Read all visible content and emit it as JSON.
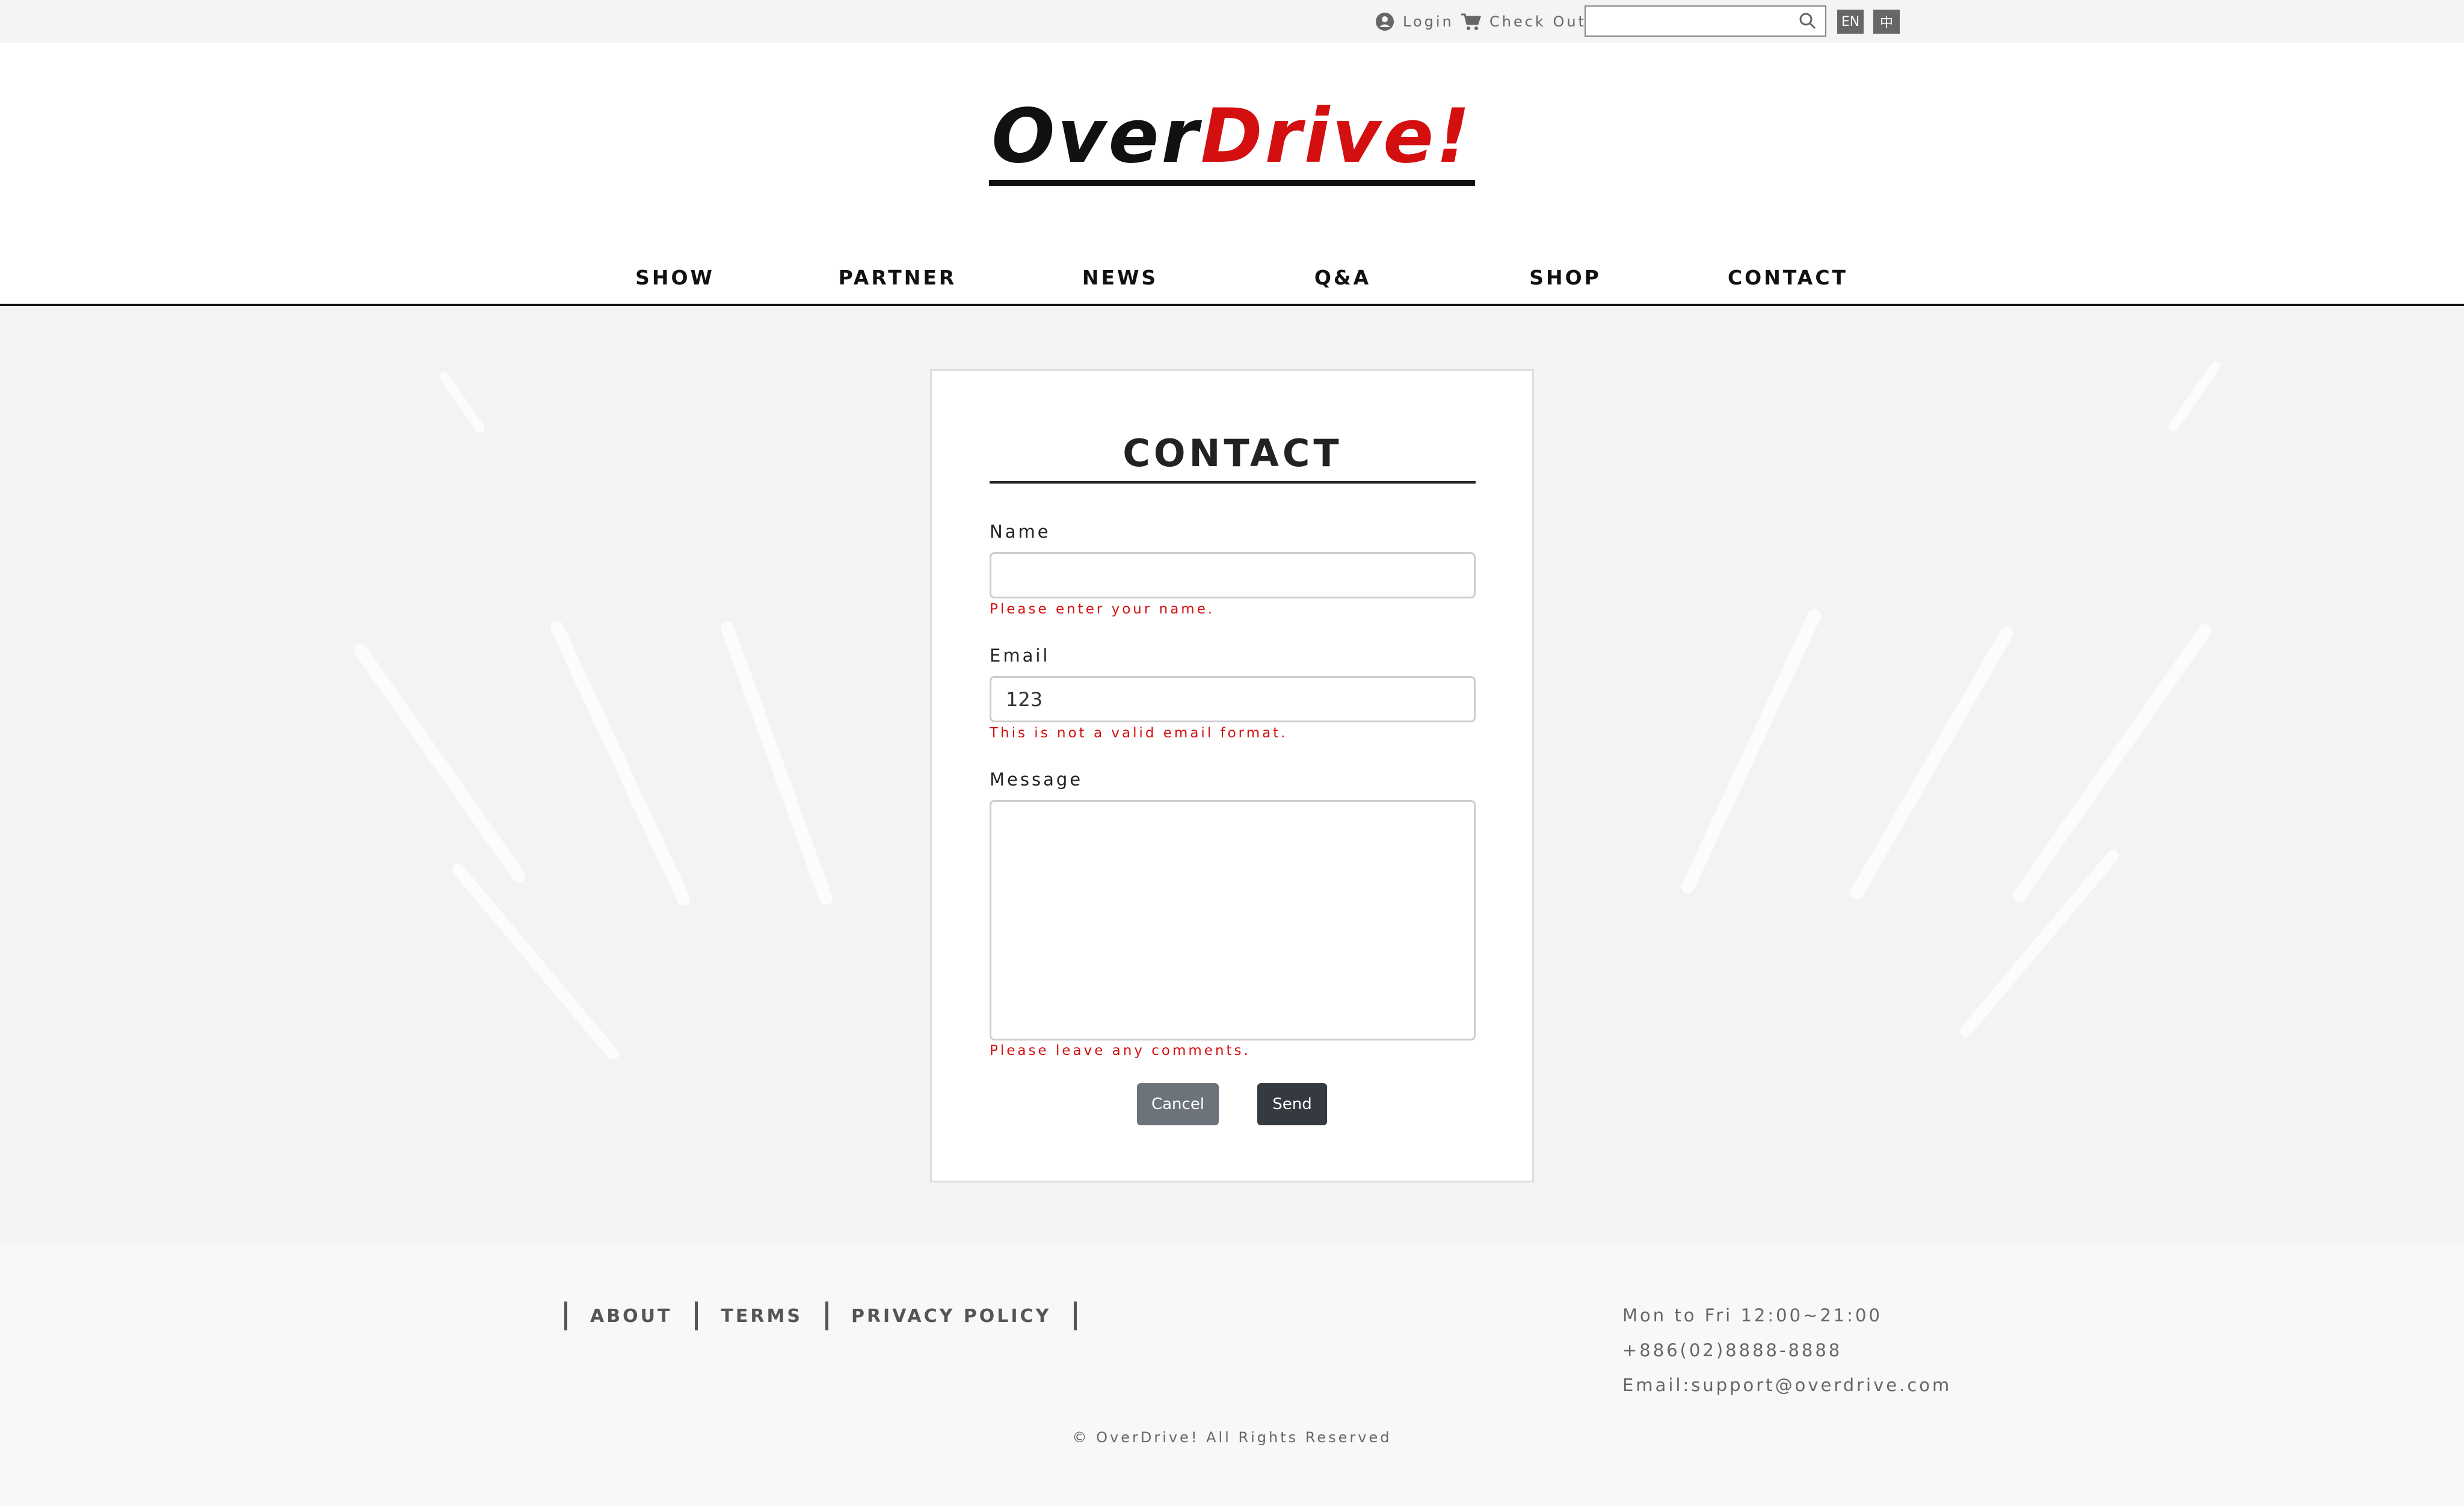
{
  "topbar": {
    "login_label": "Login",
    "checkout_label": "Check Out",
    "search_value": "",
    "lang_en": "EN",
    "lang_zh": "中"
  },
  "logo": {
    "part1": "Over",
    "part2": "Drive!"
  },
  "nav": {
    "items": [
      "SHOW",
      "PARTNER",
      "NEWS",
      "Q&A",
      "SHOP",
      "CONTACT"
    ]
  },
  "form": {
    "title": "CONTACT",
    "name_label": "Name",
    "name_value": "",
    "name_error": "Please enter your name.",
    "email_label": "Email",
    "email_value": "123",
    "email_error": "This is not a valid email format.",
    "message_label": "Message",
    "message_value": "",
    "message_error": "Please leave any comments.",
    "cancel_label": "Cancel",
    "send_label": "Send"
  },
  "footer": {
    "links": [
      "ABOUT",
      "TERMS",
      "PRIVACY POLICY"
    ],
    "hours": "Mon to Fri 12:00~21:00",
    "phone": "+886(02)8888-8888",
    "email": "Email:support@overdrive.com",
    "copyright": "© OverDrive! All Rights Reserved"
  },
  "colors": {
    "accent_red": "#d40f0f",
    "dark_button": "#343a40",
    "gray_button": "#6c737a"
  }
}
